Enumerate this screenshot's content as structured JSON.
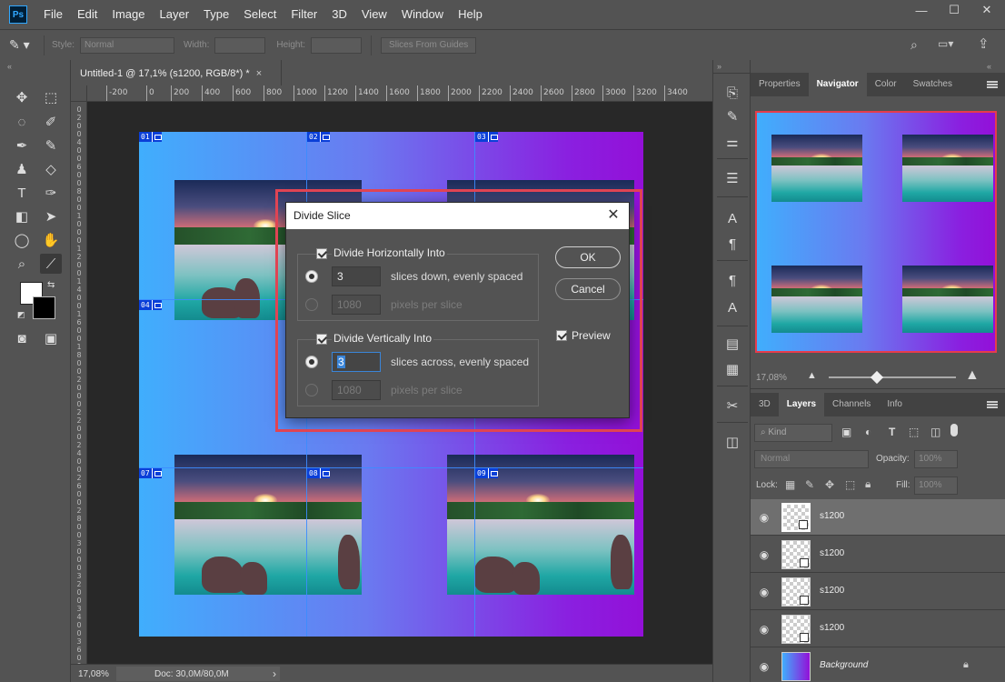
{
  "menu": {
    "logo": "Ps",
    "items": [
      "File",
      "Edit",
      "Image",
      "Layer",
      "Type",
      "Select",
      "Filter",
      "3D",
      "View",
      "Window",
      "Help"
    ]
  },
  "window_controls": {
    "minimize": "—",
    "maximize": "☐",
    "close": "✕"
  },
  "options": {
    "style_label": "Style:",
    "style_value": "Normal",
    "width_label": "Width:",
    "height_label": "Height:",
    "slices_btn": "Slices From Guides"
  },
  "document": {
    "tab_title": "Untitled-1 @ 17,1% (s1200, RGB/8*) *",
    "tab_close": "×",
    "ruler_ticks": [
      "-200",
      "0",
      "200",
      "400",
      "600",
      "800",
      "1000",
      "1200",
      "1400",
      "1600",
      "1800",
      "2000",
      "2200",
      "2400",
      "2600",
      "2800",
      "3000",
      "3200",
      "3400"
    ],
    "vruler_ticks": [
      "0",
      "2",
      "0",
      "0",
      "4",
      "0",
      "0",
      "6",
      "0",
      "0",
      "8",
      "0",
      "0",
      "1",
      "0",
      "0",
      "0",
      "1",
      "2",
      "0",
      "0",
      "1",
      "4",
      "0",
      "0",
      "1",
      "6",
      "0",
      "0",
      "1",
      "8",
      "0",
      "0",
      "2",
      "0",
      "0",
      "0",
      "2",
      "2",
      "0",
      "0",
      "2",
      "4",
      "0",
      "0",
      "2",
      "6",
      "0",
      "0",
      "2",
      "8",
      "0",
      "0",
      "3",
      "0",
      "0",
      "0",
      "3",
      "2",
      "0",
      "0",
      "3",
      "4",
      "0",
      "0",
      "3",
      "6",
      "0",
      "0"
    ],
    "slices": [
      "01",
      "02",
      "03",
      "04",
      "07",
      "08",
      "09"
    ]
  },
  "status": {
    "zoom": "17,08%",
    "doc": "Doc: 30,0M/80,0M",
    "arrow": "›"
  },
  "dialog": {
    "title": "Divide Slice",
    "close": "✕",
    "horizontal": {
      "label": "Divide Horizontally Into",
      "slices_value": "3",
      "slices_text": "slices down, evenly spaced",
      "pixels_value": "1080",
      "pixels_text": "pixels per slice"
    },
    "vertical": {
      "label": "Divide Vertically Into",
      "slices_value": "3",
      "slices_text": "slices across, evenly spaced",
      "pixels_value": "1080",
      "pixels_text": "pixels per slice"
    },
    "ok": "OK",
    "cancel": "Cancel",
    "preview": "Preview"
  },
  "panels": {
    "top_tabs": [
      "Properties",
      "Navigator",
      "Color",
      "Swatches"
    ],
    "active_top": "Navigator",
    "nav_zoom": "17,08%",
    "layer_tabs": [
      "3D",
      "Layers",
      "Channels",
      "Info"
    ],
    "active_layer_tab": "Layers",
    "filter_kind": "Kind",
    "blend_mode": "Normal",
    "opacity_label": "Opacity:",
    "opacity_value": "100%",
    "lock_label": "Lock:",
    "fill_label": "Fill:",
    "fill_value": "100%",
    "layers": [
      {
        "name": "s1200",
        "selected": true
      },
      {
        "name": "s1200",
        "selected": false
      },
      {
        "name": "s1200",
        "selected": false
      },
      {
        "name": "s1200",
        "selected": false
      },
      {
        "name": "Background",
        "selected": false
      }
    ]
  }
}
